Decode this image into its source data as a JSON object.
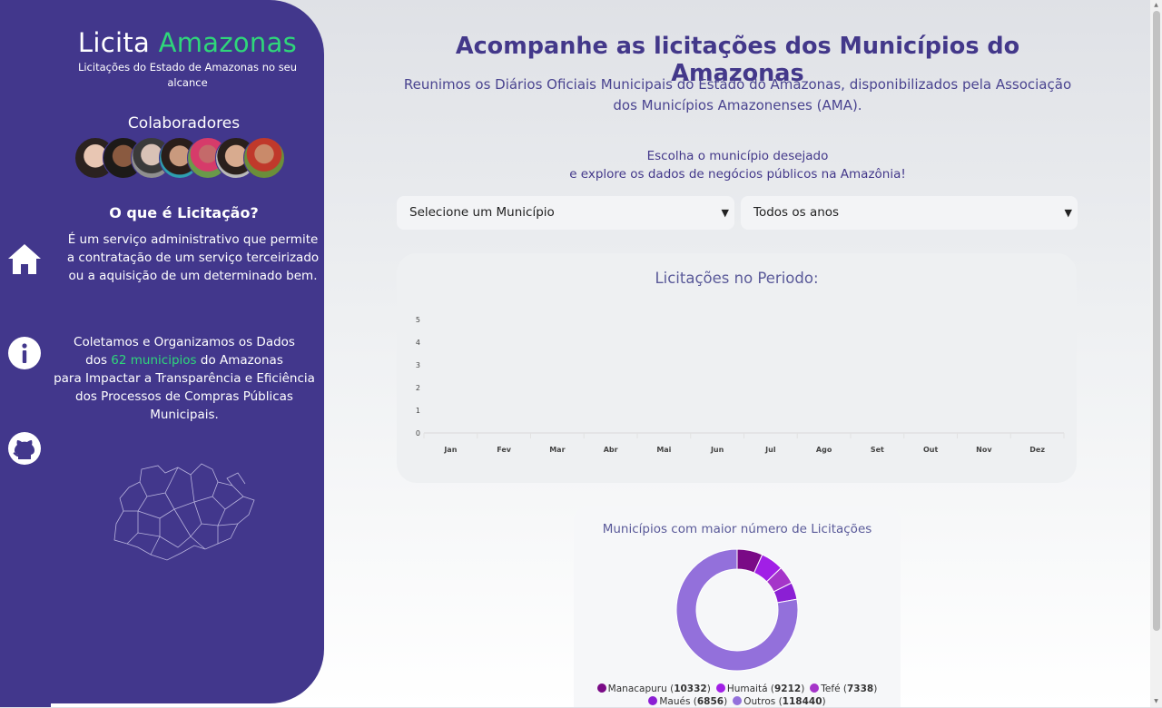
{
  "sidebar": {
    "brand_part1": "Licita",
    "brand_part2": "Amazonas",
    "tagline": "Licitações do Estado de Amazonas no seu alcance",
    "collaborators_title": "Colaboradores",
    "what_title": "O que é Licitação?",
    "what_text": "É um serviço administrativo que permite a contratação de um serviço terceirizado ou a aquisição de um determinado bem.",
    "collect_line1": "Coletamos e Organizamos os Dados",
    "collect_prefix": "dos",
    "collect_highlight": "62 municipios",
    "collect_suffix": "do Amazonas",
    "collect_line3": "para Impactar a Transparência e Eficiência",
    "collect_line4": "dos Processos de Compras Públicas",
    "collect_line5": "Municipais."
  },
  "nav": {
    "home_icon": "home-icon",
    "info_icon": "info-icon",
    "github_icon": "github-icon"
  },
  "main": {
    "title": "Acompanhe as licitações dos Municípios do Amazonas",
    "subtitle_line1": "Reunimos os Diários Oficiais Municipais do Estado do Amazonas, disponibilizados pela Associação",
    "subtitle_line2": "dos Municípios Amazonenses (AMA).",
    "choose_line1": "Escolha o município desejado",
    "choose_line2": "e explore os dados de negócios públicos na Amazônia!",
    "municipio_select": "Selecione um Município",
    "ano_select": "Todos os anos"
  },
  "chart_data": [
    {
      "type": "bar",
      "title": "Licitações no Periodo:",
      "categories": [
        "Jan",
        "Fev",
        "Mar",
        "Abr",
        "Mai",
        "Jun",
        "Jul",
        "Ago",
        "Set",
        "Out",
        "Nov",
        "Dez"
      ],
      "values": [
        0,
        0,
        0,
        0,
        0,
        0,
        0,
        0,
        0,
        0,
        0,
        0
      ],
      "yticks": [
        "0",
        "1",
        "2",
        "3",
        "4",
        "5"
      ],
      "ylim": [
        0,
        5
      ],
      "grid": "vertical"
    },
    {
      "type": "pie",
      "title": "Municípios com maior número de Licitações",
      "labels": [
        "Manacapuru",
        "Humaitá",
        "Tefé",
        "Maués",
        "Outros"
      ],
      "values": [
        10332,
        9212,
        7338,
        6856,
        118440
      ],
      "colors": [
        "#7a0a86",
        "#a11fe6",
        "#a535c9",
        "#8b1fd4",
        "#9370db"
      ]
    }
  ],
  "colors": {
    "sidebar_bg": "#42378c",
    "accent_green": "#2fd67a",
    "title_purple": "#43388a"
  }
}
